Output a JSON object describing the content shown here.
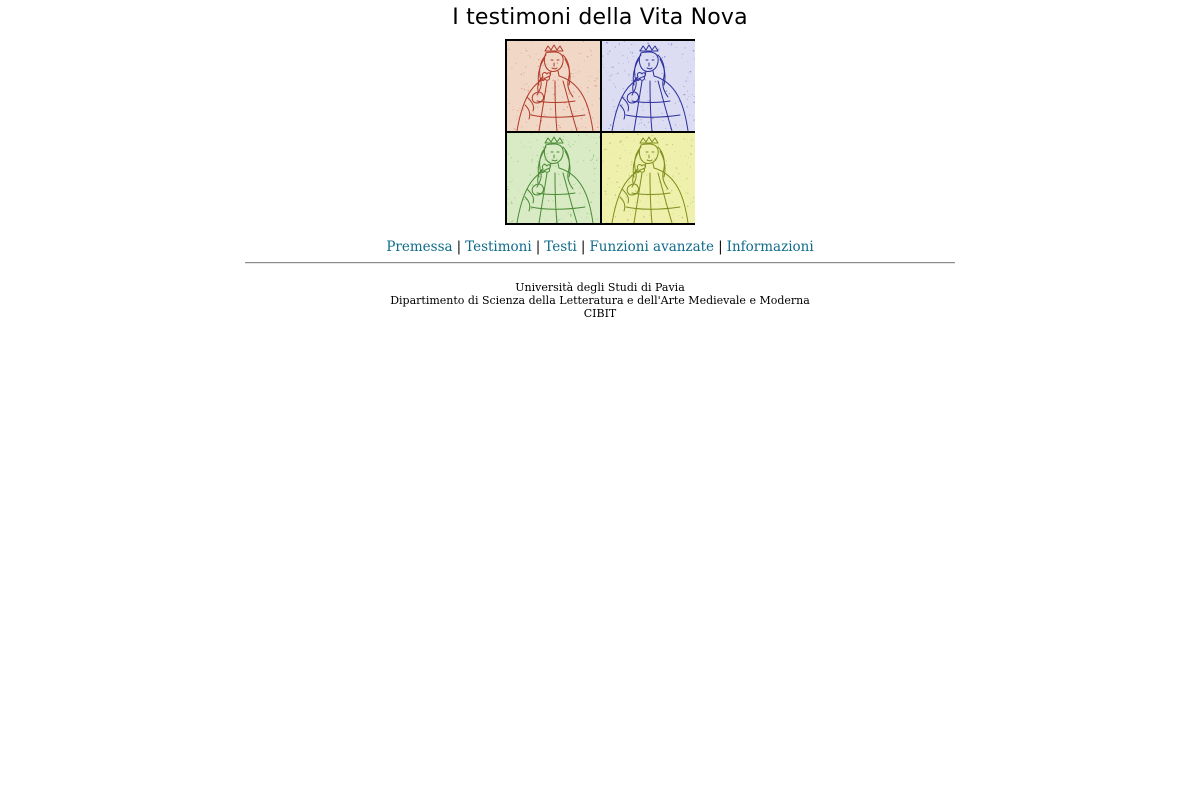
{
  "header": {
    "title": "I testimoni della Vita Nova"
  },
  "mosaic": {
    "tiles": [
      {
        "tone": "red",
        "background": "#f1d7c6",
        "ink": "#b23a2a"
      },
      {
        "tone": "blue",
        "background": "#dcddf2",
        "ink": "#2c2f9c"
      },
      {
        "tone": "green",
        "background": "#d9ebc4",
        "ink": "#4a8a36"
      },
      {
        "tone": "yellow",
        "background": "#eef0ac",
        "ink": "#7f8f1d"
      }
    ]
  },
  "nav": {
    "items": [
      {
        "label": "Premessa"
      },
      {
        "label": "Testimoni"
      },
      {
        "label": "Testi"
      },
      {
        "label": "Funzioni avanzate"
      },
      {
        "label": "Informazioni"
      }
    ],
    "separator": "|",
    "link_color": "#0f6b8a"
  },
  "footer": {
    "lines": [
      "Università degli Studi di Pavia",
      "Dipartimento di Scienza della Letteratura e dell'Arte Medievale e Moderna",
      "CIBIT"
    ]
  }
}
